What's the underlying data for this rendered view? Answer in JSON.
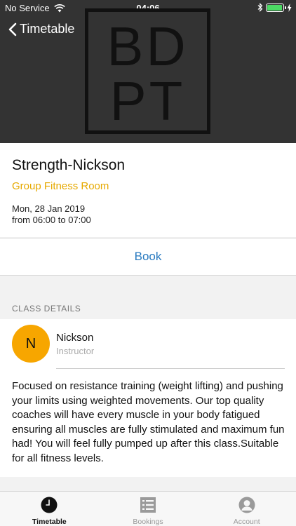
{
  "status": {
    "carrier": "No Service",
    "time": "04:06",
    "battery_level": 0.95,
    "icons": [
      "wifi-icon",
      "bluetooth-icon",
      "battery-icon",
      "charging-icon"
    ]
  },
  "nav": {
    "back_label": "Timetable"
  },
  "logo": {
    "line1": "BD",
    "line2": "PT"
  },
  "class": {
    "title": "Strength-Nickson",
    "room": "Group Fitness Room",
    "date": "Mon, 28 Jan 2019",
    "time_range": "from 06:00 to 07:00"
  },
  "actions": {
    "book_label": "Book"
  },
  "details": {
    "section_title": "CLASS DETAILS",
    "instructor_initial": "N",
    "instructor_name": "Nickson",
    "instructor_role": "Instructor",
    "description": "Focused on resistance training (weight lifting) and pushing your limits using weighted movements. Our top quality coaches will have every muscle in your body fatigued ensuring all muscles are fully stimulated and maximum fun had! You will feel fully pumped up after this class.Suitable for all fitness levels."
  },
  "tabs": [
    {
      "label": "Timetable",
      "icon": "clock-icon",
      "active": true
    },
    {
      "label": "Bookings",
      "icon": "list-icon",
      "active": false
    },
    {
      "label": "Account",
      "icon": "person-icon",
      "active": false
    }
  ],
  "colors": {
    "header_bg": "#333333",
    "accent_room": "#e6a900",
    "link_blue": "#2a7bc0",
    "avatar_bg": "#f7a600",
    "battery": "#4cd964"
  }
}
